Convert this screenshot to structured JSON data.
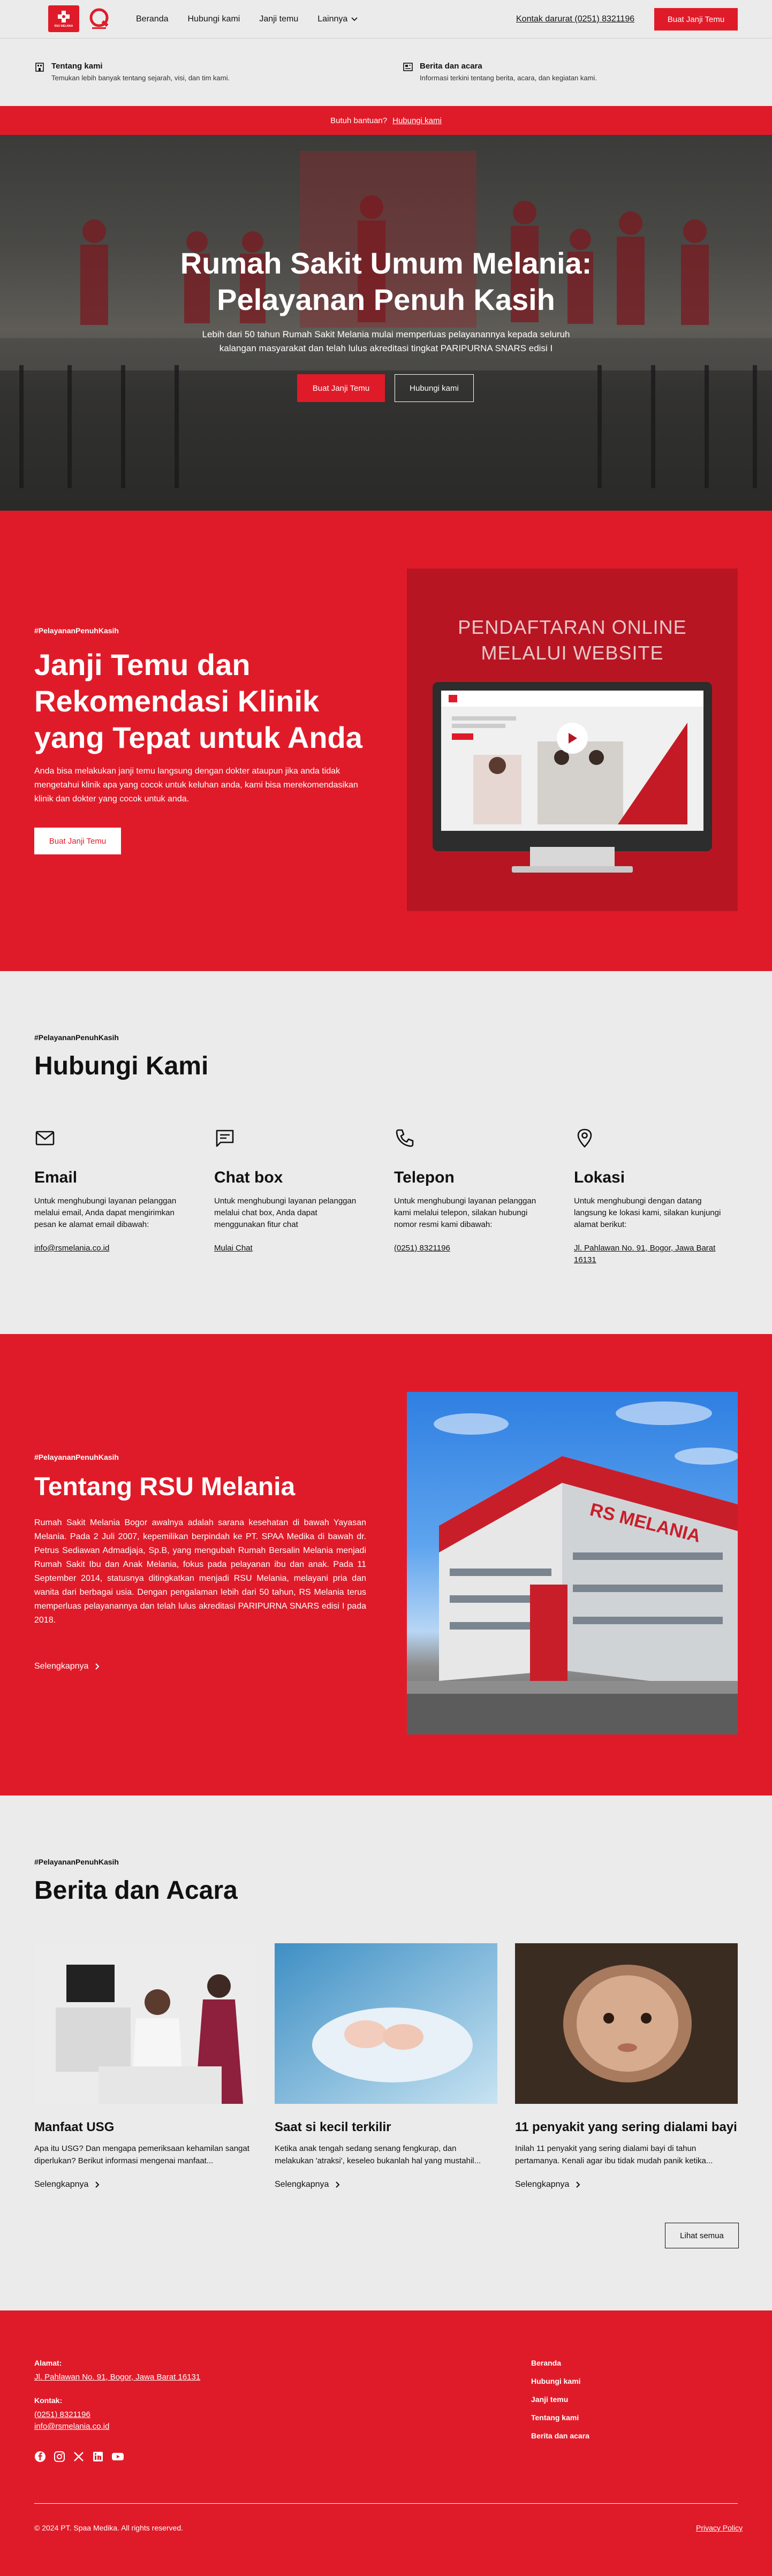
{
  "header": {
    "logo_text": "RSU MELANIA",
    "nav": [
      "Beranda",
      "Hubungi kami",
      "Janji temu",
      "Lainnya"
    ],
    "emergency": "Kontak darurat (0251) 8321196",
    "cta": "Buat Janji Temu"
  },
  "mega_menu": [
    {
      "icon": "building-icon",
      "title": "Tentang kami",
      "desc": "Temukan lebih banyak tentang sejarah, visi, dan tim kami."
    },
    {
      "icon": "news-icon",
      "title": "Berita dan acara",
      "desc": "Informasi terkini tentang berita, acara, dan kegiatan kami."
    }
  ],
  "helpbar": {
    "text": "Butuh bantuan?",
    "link": "Hubungi kami"
  },
  "hero": {
    "title_line1": "Rumah Sakit Umum Melania:",
    "title_line2": "Pelayanan Penuh Kasih",
    "body_line1": "Lebih dari 50 tahun Rumah Sakit Melania mulai memperluas pelayanannya kepada seluruh",
    "body_line2": "kalangan masyarakat dan telah lulus akreditasi tingkat PARIPURNA SNARS edisi I",
    "btn_primary": "Buat Janji Temu",
    "btn_secondary": "Hubungi kami"
  },
  "appointment": {
    "tag": "#PelayananPenuhKasih",
    "title": "Janji Temu dan Rekomendasi Klinik yang Tepat untuk Anda",
    "body": "Anda bisa melakukan janji temu langsung dengan dokter ataupun jika anda tidak mengetahui klinik apa yang cocok untuk keluhan anda, kami bisa merekomendasikan klinik dan dokter yang cocok untuk anda.",
    "button": "Buat Janji Temu",
    "video_title_1": "PENDAFTARAN ONLINE",
    "video_title_2": "MELALUI WEBSITE"
  },
  "contact": {
    "tag": "#PelayananPenuhKasih",
    "title": "Hubungi Kami",
    "items": [
      {
        "icon": "mail-icon",
        "title": "Email",
        "desc": "Untuk menghubungi layanan pelanggan melalui email, Anda dapat mengirimkan pesan ke alamat email dibawah:",
        "link": "info@rsmelania.co.id"
      },
      {
        "icon": "chat-icon",
        "title": "Chat box",
        "desc": "Untuk menghubungi layanan pelanggan melalui chat box, Anda dapat menggunakan fitur chat",
        "link": "Mulai Chat"
      },
      {
        "icon": "phone-icon",
        "title": "Telepon",
        "desc": "Untuk menghubungi layanan pelanggan kami melalui telepon, silakan hubungi nomor resmi kami dibawah:",
        "link": "(0251) 8321196"
      },
      {
        "icon": "location-icon",
        "title": "Lokasi",
        "desc": "Untuk menghubungi dengan datang langsung ke lokasi kami, silakan kunjungi alamat berikut:",
        "link": "Jl. Pahlawan No. 91, Bogor, Jawa Barat 16131"
      }
    ]
  },
  "about": {
    "tag": "#PelayananPenuhKasih",
    "title": "Tentang RSU Melania",
    "body": "Rumah Sakit Melania Bogor awalnya adalah sarana kesehatan di bawah Yayasan Melania. Pada 2 Juli 2007, kepemilikan berpindah ke PT. SPAA Medika di bawah dr. Petrus Sediawan Admadjaja, Sp.B, yang mengubah Rumah Bersalin Melania menjadi Rumah Sakit Ibu dan Anak Melania, fokus pada pelayanan ibu dan anak. Pada 11 September 2014, statusnya ditingkatkan menjadi RSU Melania, melayani pria dan wanita dari berbagai usia. Dengan pengalaman lebih dari 50 tahun, RS Melania terus memperluas pelayanannya dan telah lulus akreditasi PARIPURNA SNARS edisi I pada 2018.",
    "more": "Selengkapnya",
    "building_sign": "RS MELANIA"
  },
  "news": {
    "tag": "#PelayananPenuhKasih",
    "title": "Berita dan Acara",
    "items": [
      {
        "title": "Manfaat USG",
        "excerpt": "Apa itu USG? Dan mengapa pemeriksaan kehamilan sangat diperlukan? Berikut informasi mengenai manfaat...",
        "more": "Selengkapnya"
      },
      {
        "title": "Saat si kecil terkilir",
        "excerpt": "Ketika anak tengah sedang senang fengkurap, dan melakukan 'atraksi', keseleo bukanlah hal yang mustahil...",
        "more": "Selengkapnya"
      },
      {
        "title": "11 penyakit yang sering dialami bayi",
        "excerpt": "Inilah 11 penyakit yang sering dialami bayi di tahun pertamanya. Kenali agar ibu tidak mudah panik ketika...",
        "more": "Selengkapnya"
      }
    ],
    "see_all": "Lihat semua"
  },
  "footer": {
    "address_label": "Alamat:",
    "address": "Jl. Pahlawan No. 91, Bogor, Jawa Barat 16131",
    "contact_label": "Kontak:",
    "phone": "(0251) 8321196",
    "email": "info@rsmelania.co.id",
    "links": [
      "Beranda",
      "Hubungi kami",
      "Janji temu",
      "Tentang kami",
      "Berita dan acara"
    ],
    "copyright": "© 2024 PT. Spaa Medika. All rights reserved.",
    "privacy": "Privacy Policy"
  },
  "colors": {
    "brand_red": "#e01b29",
    "background": "#ebebeb"
  }
}
